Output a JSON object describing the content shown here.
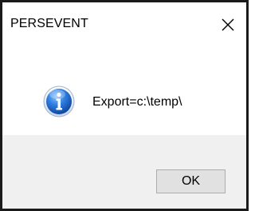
{
  "window": {
    "title": "PERSEVENT",
    "close_icon": "close-icon"
  },
  "content": {
    "icon": "info-icon",
    "message": "Export=c:\\temp\\"
  },
  "footer": {
    "ok_label": "OK"
  }
}
